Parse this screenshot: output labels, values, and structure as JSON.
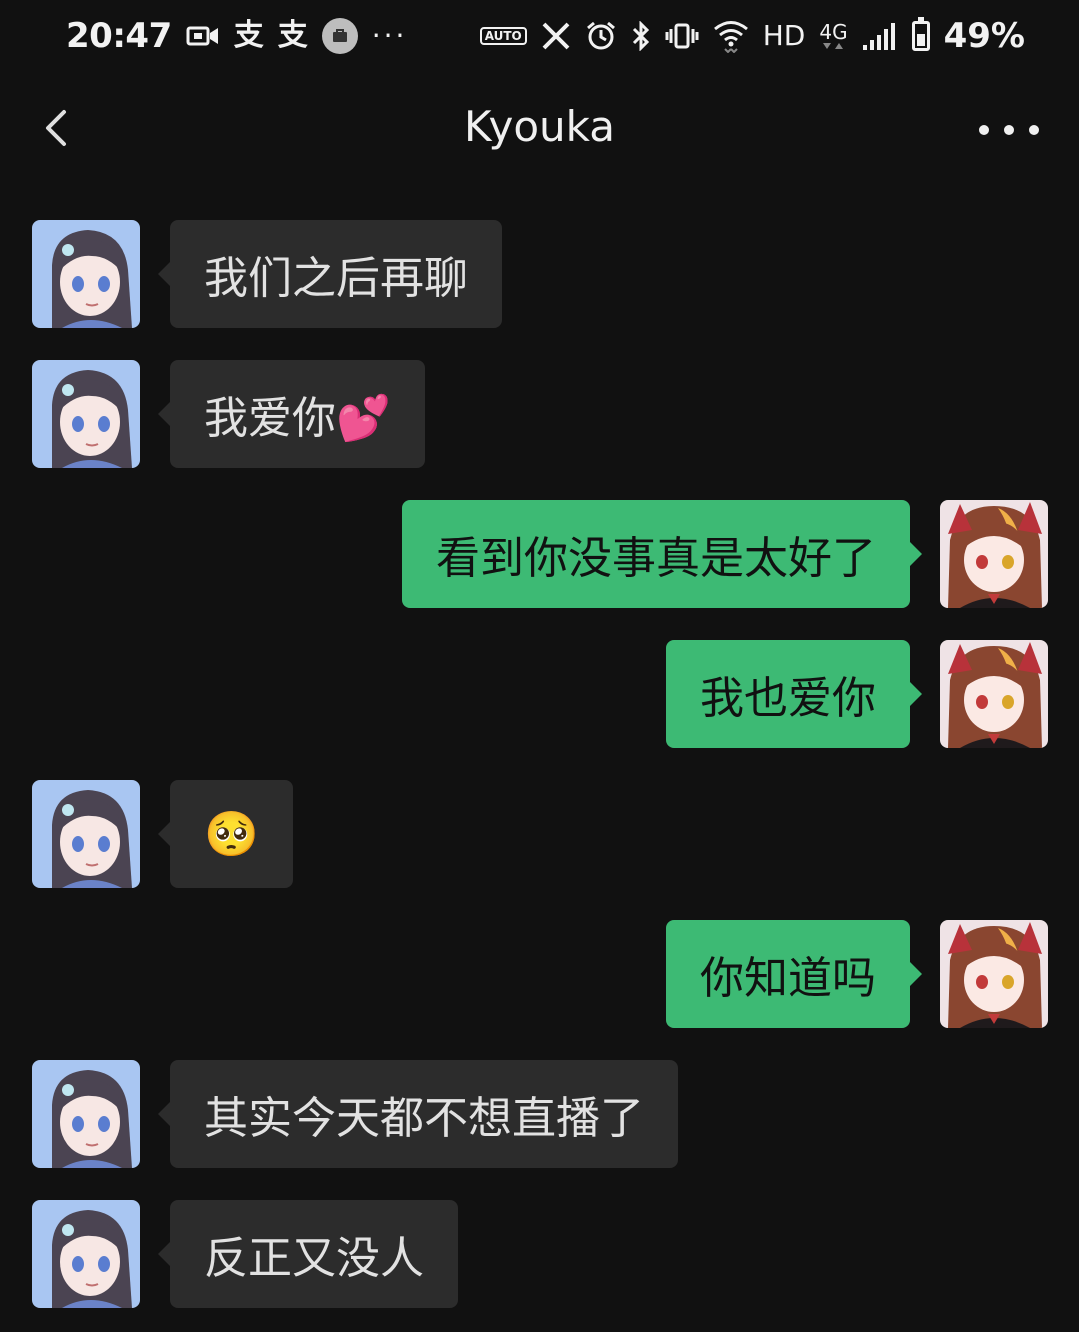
{
  "status_bar": {
    "time": "20:47",
    "left_icons": [
      "video-icon",
      "alipay-icon",
      "alipay-icon",
      "mail-notification-icon",
      "more-notifications-icon"
    ],
    "alipay_glyph": "支",
    "auto_label": "AUTO",
    "network_label": "HD",
    "network_type": "4G",
    "battery_percent": "49%",
    "battery_level": 0.49
  },
  "navbar": {
    "title": "Kyouka"
  },
  "colors": {
    "background": "#111111",
    "incoming_bubble": "#2c2c2c",
    "outgoing_bubble": "#3dba74"
  },
  "messages": [
    {
      "direction": "in",
      "text": "我们之后再聊"
    },
    {
      "direction": "in",
      "text": "我爱你💕"
    },
    {
      "direction": "out",
      "text": "看到你没事真是太好了"
    },
    {
      "direction": "out",
      "text": "我也爱你"
    },
    {
      "direction": "in",
      "text": "🥺"
    },
    {
      "direction": "out",
      "text": "你知道吗"
    },
    {
      "direction": "in",
      "text": "其实今天都不想直播了"
    },
    {
      "direction": "in",
      "text": "反正又没人"
    }
  ]
}
